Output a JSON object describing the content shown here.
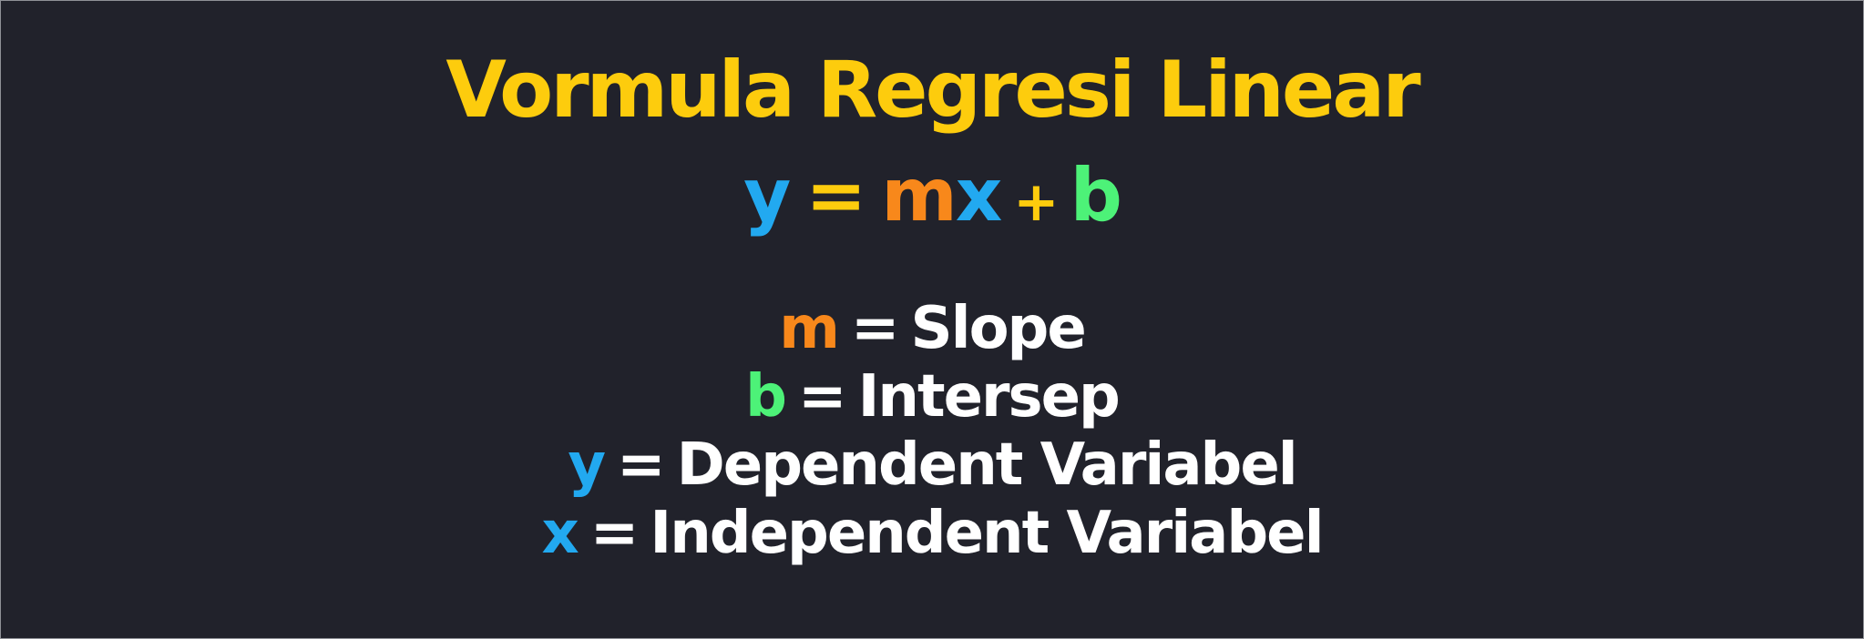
{
  "colors": {
    "background": "#21222b",
    "title": "#fdcc0d",
    "y": "#22a9f0",
    "x": "#22a9f0",
    "m": "#f8881b",
    "b": "#4df278",
    "operator": "#fdcc0d",
    "text": "#ffffff"
  },
  "title": "Vormula Regresi Linear",
  "formula": {
    "y": "y",
    "equals": "=",
    "m": "m",
    "x": "x",
    "plus": "+",
    "b": "b"
  },
  "definitions": [
    {
      "symbol": "m",
      "equals": "=",
      "label": "Slope"
    },
    {
      "symbol": "b",
      "equals": "=",
      "label": "Intersep"
    },
    {
      "symbol": "y",
      "equals": "=",
      "label": "Dependent Variabel"
    },
    {
      "symbol": "x",
      "equals": "=",
      "label": "Independent Variabel"
    }
  ]
}
